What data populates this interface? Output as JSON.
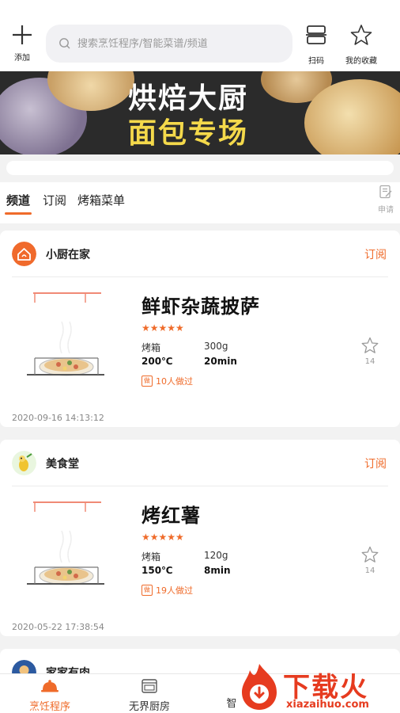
{
  "topbar": {
    "add_label": "添加",
    "search_placeholder": "搜索烹饪程序/智能菜谱/频道",
    "scan_label": "扫码",
    "favorites_label": "我的收藏"
  },
  "banner": {
    "title_line1": "烘焙大厨",
    "title_line2": "面包专场"
  },
  "tabs": {
    "items": [
      "频道",
      "订阅",
      "烤箱菜单"
    ],
    "active_index": 0,
    "apply_label": "申请"
  },
  "cards": [
    {
      "channel_name": "小厨在家",
      "subscribe_label": "订阅",
      "dish_title": "鲜虾杂蔬披萨",
      "rating": "★★★★★",
      "mode_label": "烤箱",
      "weight": "300g",
      "temperature": "200℃",
      "time": "20min",
      "made_count": "10人做过",
      "made_icon": "做",
      "fav_count": "14",
      "date": "2020-09-16 14:13:12"
    },
    {
      "channel_name": "美食堂",
      "subscribe_label": "订阅",
      "dish_title": "烤红薯",
      "rating": "★★★★★",
      "mode_label": "烤箱",
      "weight": "120g",
      "temperature": "150℃",
      "time": "8min",
      "made_count": "19人做过",
      "made_icon": "做",
      "fav_count": "14",
      "date": "2020-05-22 17:38:54"
    },
    {
      "channel_name": "家家有肉"
    }
  ],
  "bottom_nav": {
    "items": [
      "烹饪程序",
      "无界厨房",
      "智"
    ],
    "active_index": 0
  },
  "watermark": {
    "brand": "下载火",
    "url": "xiazaihuo.com"
  },
  "colors": {
    "accent": "#ef6b2a",
    "watermark": "#e63b1f"
  }
}
